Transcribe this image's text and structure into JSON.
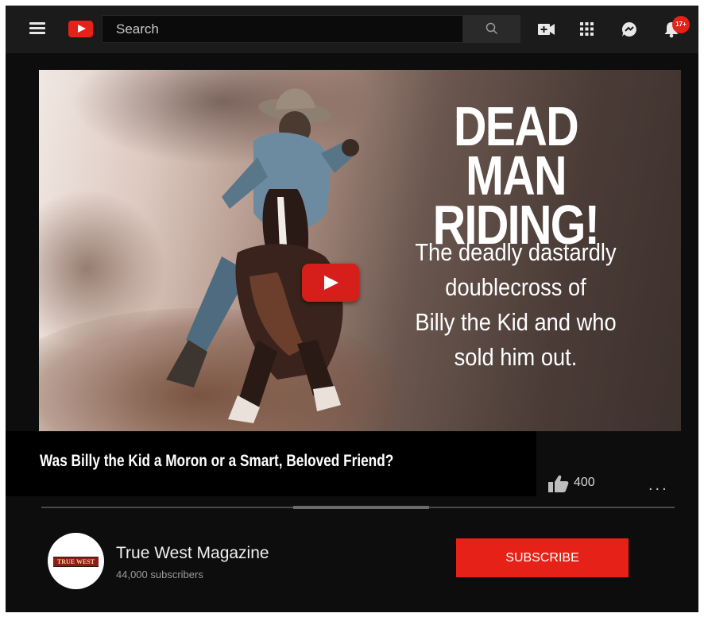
{
  "topbar": {
    "search_placeholder": "Search",
    "notification_count": "17+",
    "icons": [
      "menu-icon",
      "youtube-logo",
      "search-icon",
      "create-video-icon",
      "apps-grid-icon",
      "messages-icon",
      "notifications-bell-icon"
    ]
  },
  "video": {
    "headline_line1": "DEAD MAN",
    "headline_line2": "RIDING!",
    "subhead_line1": "The deadly dastardly",
    "subhead_line2": "doublecross of",
    "subhead_line3": "Billy the Kid and who",
    "subhead_line4": "sold him out.",
    "title": "Was Billy the Kid a Moron or a Smart, Beloved Friend?",
    "likes": "400",
    "more": "..."
  },
  "channel": {
    "name": "True West Magazine",
    "subscribers": "44,000 subscribers",
    "logo_text": "TRUE WEST",
    "subscribe_label": "SUBSCRIBE"
  },
  "colors": {
    "accent": "#e62117",
    "background": "#0d0d0d",
    "topbar": "#1b1b1b"
  }
}
